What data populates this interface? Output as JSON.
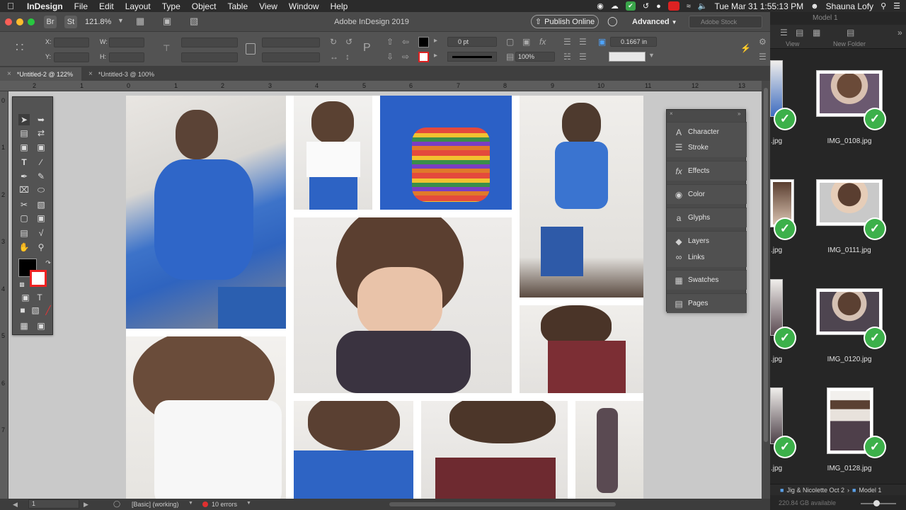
{
  "menubar": {
    "app_name": "InDesign",
    "items": [
      "File",
      "Edit",
      "Layout",
      "Type",
      "Object",
      "Table",
      "View",
      "Window",
      "Help"
    ],
    "datetime": "Tue Mar 31  1:55:13 PM",
    "user": "Shauna Lofy"
  },
  "appbar": {
    "bridge_label": "Br",
    "stock_label": "St",
    "zoom": "121.8%",
    "title": "Adobe InDesign 2019",
    "publish_label": "Publish Online",
    "workspace": "Advanced",
    "search_placeholder": "Adobe Stock"
  },
  "control": {
    "x_label": "X:",
    "y_label": "Y:",
    "w_label": "W:",
    "h_label": "H:",
    "stroke_weight": "0 pt",
    "opacity": "100%",
    "offset_value": "0.1667 in"
  },
  "tabs": [
    {
      "label": "*Untitled-2 @ 122%",
      "active": true
    },
    {
      "label": "*Untitled-3 @ 100%",
      "active": false
    }
  ],
  "ruler": {
    "h": [
      "2",
      "1",
      "0",
      "1",
      "2",
      "3",
      "4",
      "5",
      "6",
      "7",
      "8",
      "9",
      "10",
      "11",
      "12",
      "13"
    ],
    "v": [
      "0",
      "1",
      "2",
      "3",
      "4",
      "5",
      "6",
      "7"
    ]
  },
  "panels": [
    {
      "label": "Character",
      "icon": "character-icon"
    },
    {
      "label": "Stroke",
      "icon": "stroke-icon"
    },
    {
      "label": "Effects",
      "icon": "effects-icon"
    },
    {
      "label": "Color",
      "icon": "color-icon"
    },
    {
      "label": "Glyphs",
      "icon": "glyphs-icon"
    },
    {
      "label": "Layers",
      "icon": "layers-icon"
    },
    {
      "label": "Links",
      "icon": "links-icon"
    },
    {
      "label": "Swatches",
      "icon": "swatches-icon"
    },
    {
      "label": "Pages",
      "icon": "pages-icon"
    }
  ],
  "status": {
    "page": "1",
    "style": "[Basic] (working)",
    "errors": "10 errors"
  },
  "bridge": {
    "model_label": "Model 1",
    "view_label": "View",
    "new_folder_label": "New Folder",
    "files": [
      {
        "name": "IMG_0108.jpg",
        "partial": ".jpg"
      },
      {
        "name": "IMG_0111.jpg",
        "partial": ".jpg"
      },
      {
        "name": "IMG_0120.jpg",
        "partial": ".jpg"
      },
      {
        "name": "IMG_0128.jpg",
        "partial": ".jpg"
      }
    ],
    "path_folder": "Jig & Nicolette Oct 2",
    "path_model": "Model 1",
    "disk": "220.84 GB available"
  },
  "colors": {
    "accent_green": "#3cb04a",
    "ui_dark": "#535353"
  }
}
